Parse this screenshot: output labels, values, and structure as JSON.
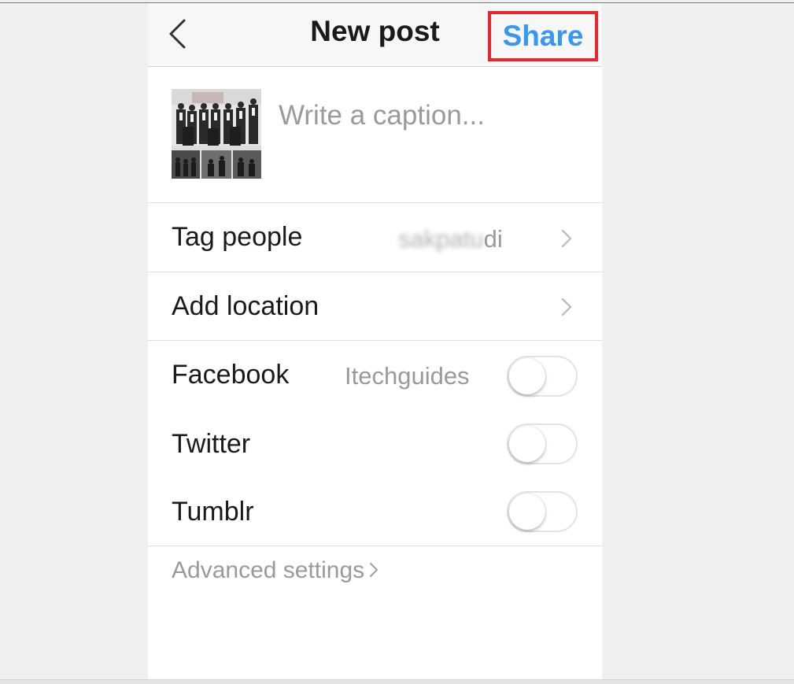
{
  "header": {
    "title": "New post",
    "share_label": "Share",
    "back_icon": "chevron-left-icon"
  },
  "composer": {
    "caption_placeholder": "Write a caption...",
    "thumbnail": "group-photo-collage"
  },
  "rows": {
    "tag_people": {
      "label": "Tag people",
      "value_obscured": "sakpatudi",
      "value_visible": "di"
    },
    "add_location": {
      "label": "Add location"
    },
    "facebook": {
      "label": "Facebook",
      "account": "Itechguides",
      "enabled": false
    },
    "twitter": {
      "label": "Twitter",
      "enabled": false
    },
    "tumblr": {
      "label": "Tumblr",
      "enabled": false
    }
  },
  "advanced": {
    "label": "Advanced settings"
  },
  "colors": {
    "accent": "#3897f0",
    "highlight_box": "#e8262d",
    "muted_text": "#9a9a9a",
    "primary_text": "#1a1a1a"
  }
}
